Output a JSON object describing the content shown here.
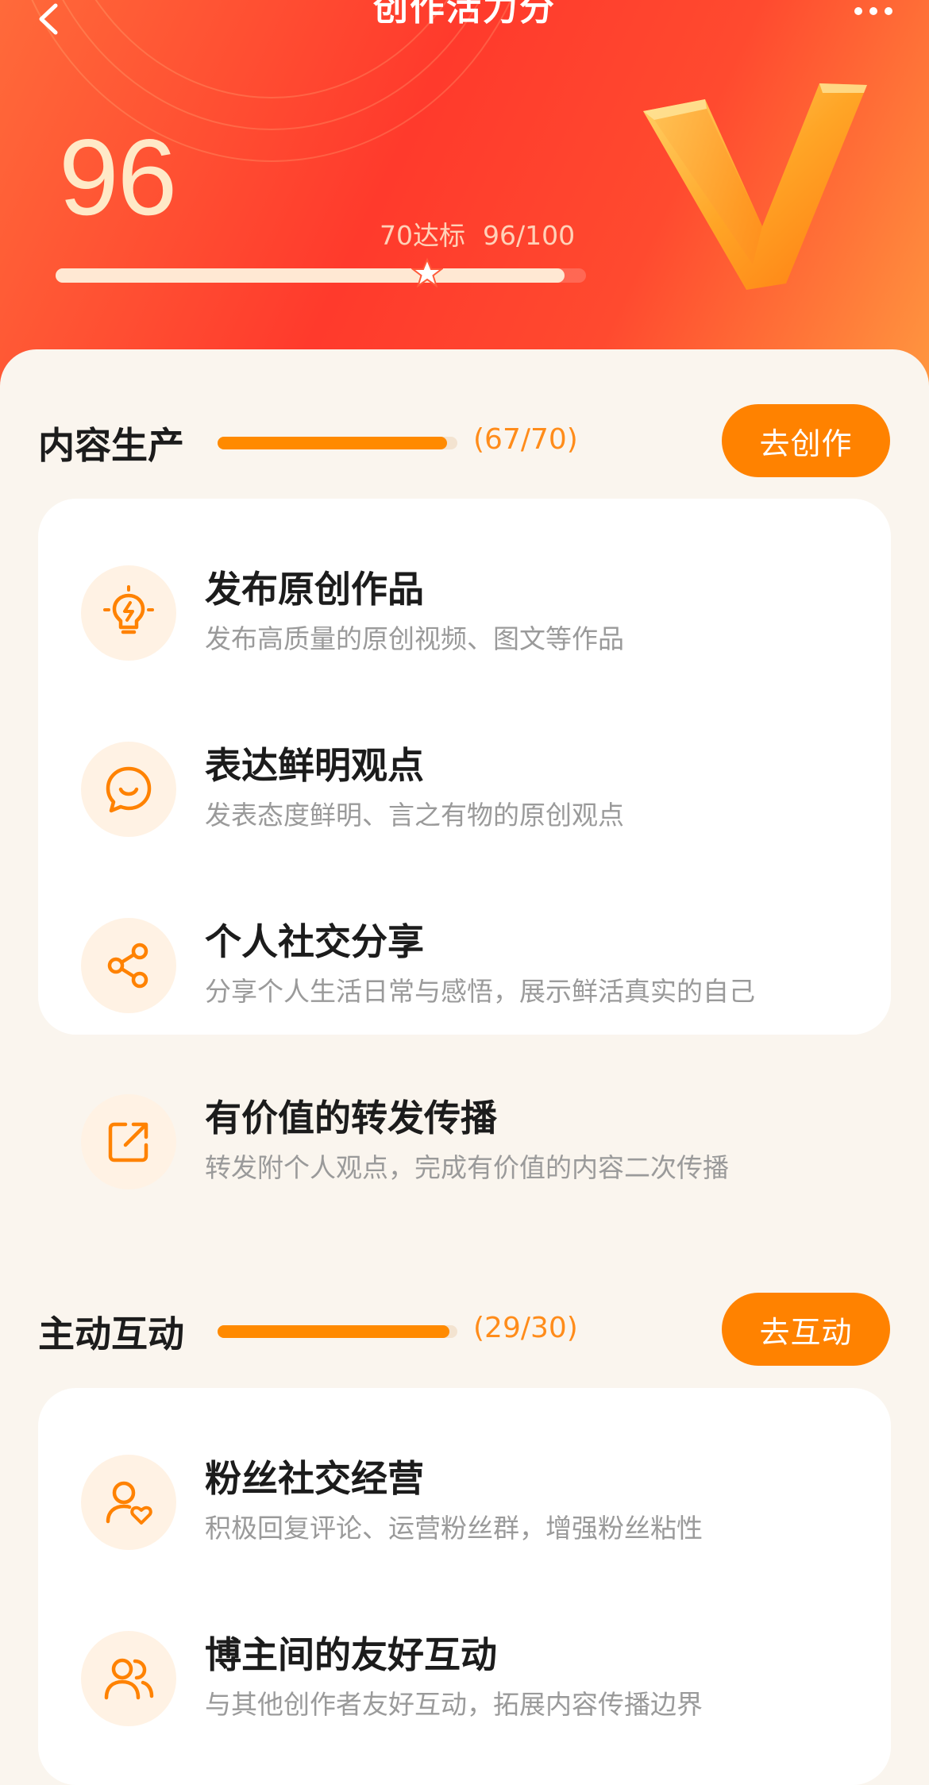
{
  "header": {
    "title": "创作活力分",
    "score": "96",
    "target_text": "70达标",
    "progress_text": "96/100",
    "progress_fraction": 0.96,
    "threshold_fraction": 0.7
  },
  "sections": [
    {
      "title": "内容生产",
      "count": "(67/70)",
      "progress": 0.957,
      "button": "去创作",
      "items": [
        {
          "title": "发布原创作品",
          "desc": "发布高质量的原创视频、图文等作品",
          "icon": "lightbulb-icon"
        },
        {
          "title": "表达鲜明观点",
          "desc": "发表态度鲜明、言之有物的原创观点",
          "icon": "smile-chat-icon"
        },
        {
          "title": "个人社交分享",
          "desc": "分享个人生活日常与感悟，展示鲜活真实的自己",
          "icon": "share-icon"
        },
        {
          "title": "有价值的转发传播",
          "desc": "转发附个人观点，完成有价值的内容二次传播",
          "icon": "forward-icon"
        }
      ]
    },
    {
      "title": "主动互动",
      "count": "(29/30)",
      "progress": 0.967,
      "button": "去互动",
      "items": [
        {
          "title": "粉丝社交经营",
          "desc": "积极回复评论、运营粉丝群，增强粉丝粘性",
          "icon": "user-heart-icon"
        },
        {
          "title": "博主间的友好互动",
          "desc": "与其他创作者友好互动，拓展内容传播边界",
          "icon": "users-icon"
        }
      ]
    }
  ],
  "colors": {
    "accent": "#ff8200",
    "hero_red": "#ff3a2c",
    "icon_bg": "#fff2e4"
  }
}
